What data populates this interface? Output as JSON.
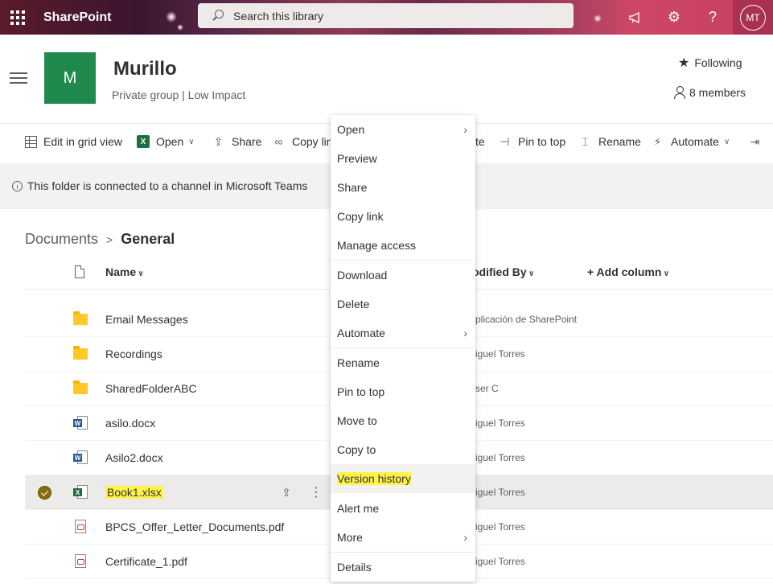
{
  "suite": {
    "brand": "SharePoint",
    "search_placeholder": "Search this library",
    "avatar_initials": "MT",
    "help_label": "?"
  },
  "site": {
    "logo_letter": "M",
    "title": "Murillo",
    "subtitle": "Private group | Low Impact",
    "following_label": "Following",
    "members_label": "8 members"
  },
  "commandbar": {
    "edit_grid": "Edit in grid view",
    "open": "Open",
    "share": "Share",
    "copy_link": "Copy lin",
    "delete_partial": "te",
    "pin_to_top": "Pin to top",
    "rename": "Rename",
    "automate": "Automate"
  },
  "infobar": {
    "text": "This folder is connected to a channel in Microsoft Teams"
  },
  "breadcrumb": {
    "root": "Documents",
    "current": "General"
  },
  "columns": {
    "name": "Name",
    "modified_by": "odified By",
    "add_column": "Add column"
  },
  "rows": [
    {
      "type": "folder",
      "name": "Email Messages",
      "modified_by": "plicación de SharePoint"
    },
    {
      "type": "folder",
      "name": "Recordings",
      "modified_by": "iguel Torres"
    },
    {
      "type": "folder",
      "name": "SharedFolderABC",
      "modified_by": "ser C"
    },
    {
      "type": "word",
      "name": "asilo.docx",
      "modified_by": "iguel Torres"
    },
    {
      "type": "word",
      "name": "Asilo2.docx",
      "modified_by": "iguel Torres"
    },
    {
      "type": "excel",
      "name": "Book1.xlsx",
      "modified_by": "iguel Torres",
      "selected": true
    },
    {
      "type": "pdf",
      "name": "BPCS_Offer_Letter_Documents.pdf",
      "modified_by": "iguel Torres"
    },
    {
      "type": "pdf",
      "name": "Certificate_1.pdf",
      "modified_by": "iguel Torres"
    }
  ],
  "context_menu": {
    "items": [
      {
        "label": "Open",
        "submenu": true
      },
      {
        "label": "Preview"
      },
      {
        "label": "Share"
      },
      {
        "label": "Copy link"
      },
      {
        "label": "Manage access"
      },
      {
        "label": "Download"
      },
      {
        "label": "Delete"
      },
      {
        "label": "Automate",
        "submenu": true
      },
      {
        "label": "Rename"
      },
      {
        "label": "Pin to top"
      },
      {
        "label": "Move to"
      },
      {
        "label": "Copy to"
      },
      {
        "label": "Version history",
        "hovered": true
      },
      {
        "label": "Alert me"
      },
      {
        "label": "More",
        "submenu": true
      },
      {
        "label": "Details"
      }
    ]
  },
  "colors": {
    "site_logo": "#208a4e",
    "highlight": "#fff34a",
    "selected_row": "#edebe9"
  }
}
